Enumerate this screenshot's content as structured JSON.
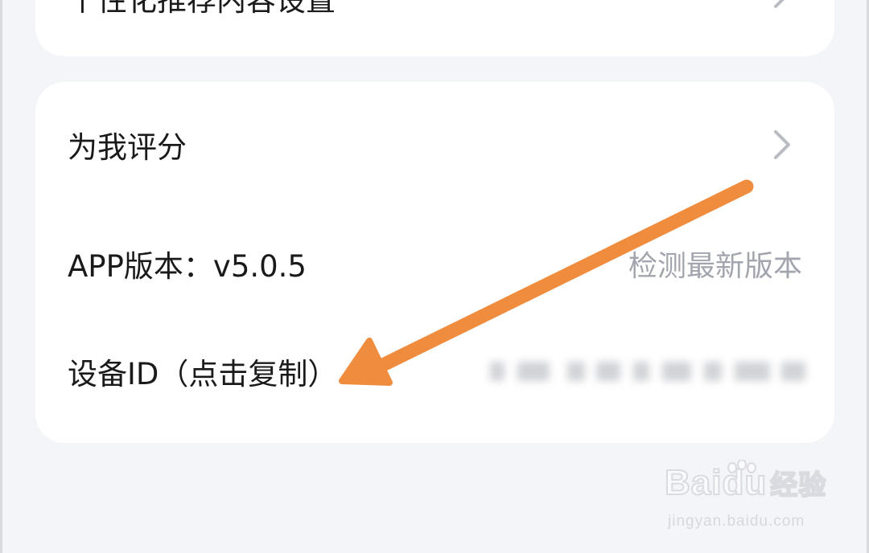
{
  "settings": {
    "top_item": {
      "label": "个性化推荐内容设置",
      "chevron_icon": "chevron-right-icon"
    },
    "rate_item": {
      "label": "为我评分",
      "chevron_icon": "chevron-right-icon"
    },
    "version_item": {
      "label": "APP版本：v5.0.5",
      "action_label": "检测最新版本"
    },
    "device_item": {
      "label": "设备ID（点击复制）",
      "value_state": "blurred"
    }
  },
  "annotation": {
    "arrow_color": "#ef8c3e",
    "arrow_target": "device-id-row"
  },
  "watermark": {
    "brand": "Baidu",
    "brand_cn": "经验",
    "site": "jingyan.baidu.com"
  },
  "colors": {
    "background": "#f4f5f9",
    "card": "#ffffff",
    "text": "#1a1a1a",
    "secondary_text": "#a2a5ad",
    "chevron": "#b9bcc2"
  }
}
